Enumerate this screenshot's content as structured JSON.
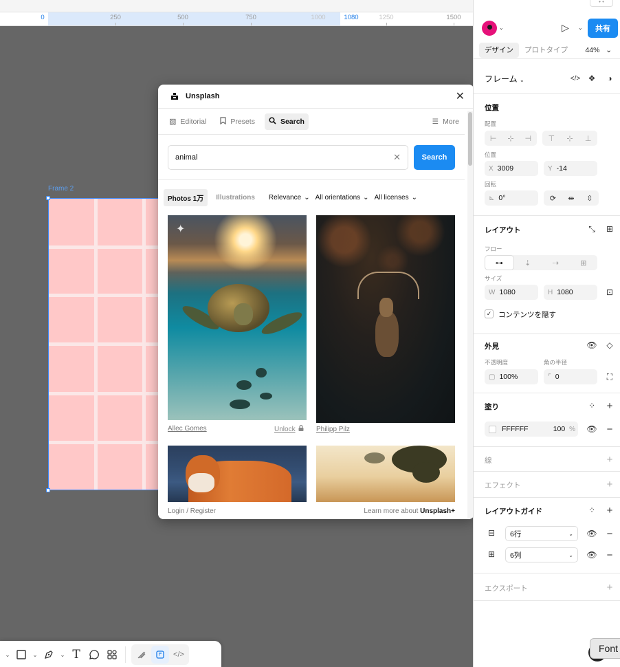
{
  "ruler": {
    "ticks": [
      "0",
      "250",
      "500",
      "750",
      "1000",
      "1080",
      "1250",
      "1500"
    ]
  },
  "canvas": {
    "frame_label": "Frame 2",
    "frame_color": "#ffc8c8",
    "selection_color": "#3d8bfd"
  },
  "toolbar": {
    "tools": [
      "frame-icon",
      "rectangle-icon",
      "pen-icon",
      "text-icon",
      "comment-icon",
      "components-icon",
      "draw-icon",
      "dev-mode-icon",
      "code-icon"
    ]
  },
  "plugin": {
    "title": "Unsplash",
    "tabs": [
      {
        "label": "Editorial",
        "icon": "image-icon"
      },
      {
        "label": "Presets",
        "icon": "bookmark-icon"
      },
      {
        "label": "Search",
        "icon": "search-icon"
      }
    ],
    "active_tab": "Search",
    "more_label": "More",
    "search_value": "animal",
    "search_button": "Search",
    "filters": {
      "photos": "Photos 1万",
      "illustrations": "Illustrations",
      "relevance": "Relevance",
      "orientation": "All orientations",
      "licenses": "All licenses"
    },
    "photos": [
      {
        "author": "Allec Gomes",
        "unlock": "Unlock"
      },
      {
        "author": "Philipp Pilz"
      }
    ],
    "footer_left": "Login / Register",
    "footer_right_prefix": "Learn more about",
    "footer_right_link": "Unsplash+",
    "accent": "#1b8bf2"
  },
  "panel": {
    "share_label": "共有",
    "tabs": [
      "デザイン",
      "プロトタイプ"
    ],
    "zoom": "44%",
    "frame_title": "フレーム",
    "position": {
      "title": "位置",
      "align_label": "配置",
      "pos_label": "位置",
      "x_prefix": "X",
      "x": "3009",
      "y_prefix": "Y",
      "y": "-14",
      "rotation_label": "回転",
      "rotation": "0°"
    },
    "layout": {
      "title": "レイアウト",
      "flow_label": "フロー",
      "size_label": "サイズ",
      "w_prefix": "W",
      "w": "1080",
      "h_prefix": "H",
      "h": "1080",
      "clip_label": "コンテンツを隠す"
    },
    "appearance": {
      "title": "外見",
      "opacity_label": "不透明度",
      "radius_label": "角の半径",
      "opacity": "100%",
      "radius": "0"
    },
    "fill": {
      "title": "塗り",
      "hex": "FFFFFF",
      "opacity": "100",
      "unit": "%"
    },
    "stroke_title": "線",
    "effects_title": "エフェクト",
    "layout_guide": {
      "title": "レイアウトガイド",
      "rows": "6行",
      "cols": "6列"
    },
    "export_title": "エクスポート",
    "font_pill": "Font"
  }
}
